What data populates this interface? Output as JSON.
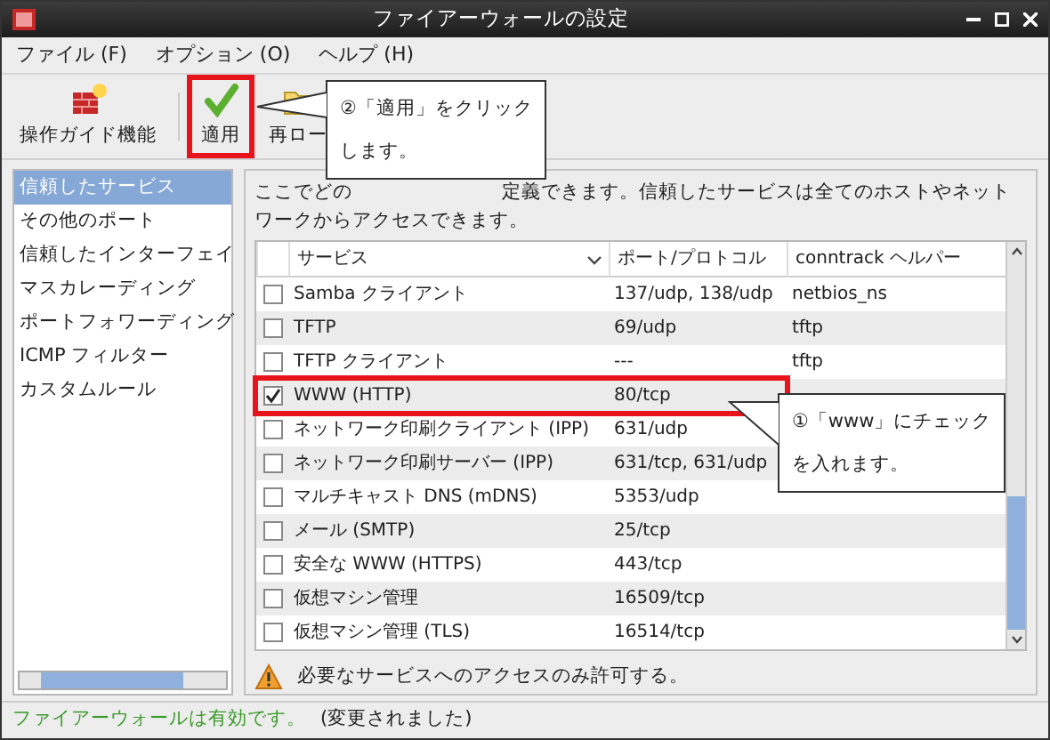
{
  "window": {
    "title": "ファイアーウォールの設定"
  },
  "menu": [
    "ファイル (F)",
    "オプション (O)",
    "ヘルプ (H)"
  ],
  "toolbar": [
    {
      "kind": "wizard",
      "label": "操作ガイド機能",
      "highlighted": false
    },
    {
      "kind": "apply",
      "label": "適用",
      "highlighted": true
    },
    {
      "kind": "reload",
      "label": "再ロー",
      "highlighted": false
    }
  ],
  "sidebar": {
    "items": [
      {
        "label": "信頼したサービス",
        "selected": true
      },
      {
        "label": "その他のポート",
        "selected": false
      },
      {
        "label": "信頼したインターフェイ",
        "selected": false
      },
      {
        "label": "マスカレーディング",
        "selected": false
      },
      {
        "label": "ポートフォワーディング",
        "selected": false
      },
      {
        "label": "ICMP フィルター",
        "selected": false
      },
      {
        "label": "カスタムルール",
        "selected": false
      }
    ]
  },
  "description": {
    "part_1": "ここでどの",
    "part_2": "定義できます。信頼したサービスは全てのホストやネット",
    "part_3": "ワークからアクセスできます。"
  },
  "table": {
    "columns": [
      "サービス",
      "ポート/プロトコル",
      "conntrack ヘルパー"
    ],
    "rows": [
      {
        "service": "Samba クライアント",
        "ports": "137/udp, 138/udp",
        "helper": "netbios_ns",
        "checked": false,
        "highlighted": false
      },
      {
        "service": "TFTP",
        "ports": "69/udp",
        "helper": "tftp",
        "checked": false,
        "highlighted": false
      },
      {
        "service": "TFTP クライアント",
        "ports": "---",
        "helper": "tftp",
        "checked": false,
        "highlighted": false
      },
      {
        "service": "WWW (HTTP)",
        "ports": "80/tcp",
        "helper": "",
        "checked": true,
        "highlighted": true
      },
      {
        "service": "ネットワーク印刷クライアント (IPP)",
        "ports": "631/udp",
        "helper": "",
        "checked": false,
        "highlighted": false
      },
      {
        "service": "ネットワーク印刷サーバー (IPP)",
        "ports": "631/tcp, 631/udp",
        "helper": "",
        "checked": false,
        "highlighted": false
      },
      {
        "service": "マルチキャスト DNS (mDNS)",
        "ports": "5353/udp",
        "helper": "",
        "checked": false,
        "highlighted": false
      },
      {
        "service": "メール (SMTP)",
        "ports": "25/tcp",
        "helper": "",
        "checked": false,
        "highlighted": false
      },
      {
        "service": "安全な WWW (HTTPS)",
        "ports": "443/tcp",
        "helper": "",
        "checked": false,
        "highlighted": false
      },
      {
        "service": "仮想マシン管理",
        "ports": "16509/tcp",
        "helper": "",
        "checked": false,
        "highlighted": false
      },
      {
        "service": "仮想マシン管理 (TLS)",
        "ports": "16514/tcp",
        "helper": "",
        "checked": false,
        "highlighted": false
      }
    ]
  },
  "warning": "必要なサービスへのアクセスのみ許可する。",
  "status_bar": {
    "state": "ファイアーウォールは有効です。",
    "note": "(変更されました)"
  },
  "callouts": [
    {
      "lines": [
        "②「適用」をクリック",
        "します。"
      ]
    },
    {
      "lines": [
        "①「www」にチェック",
        "を入れます。"
      ]
    }
  ]
}
